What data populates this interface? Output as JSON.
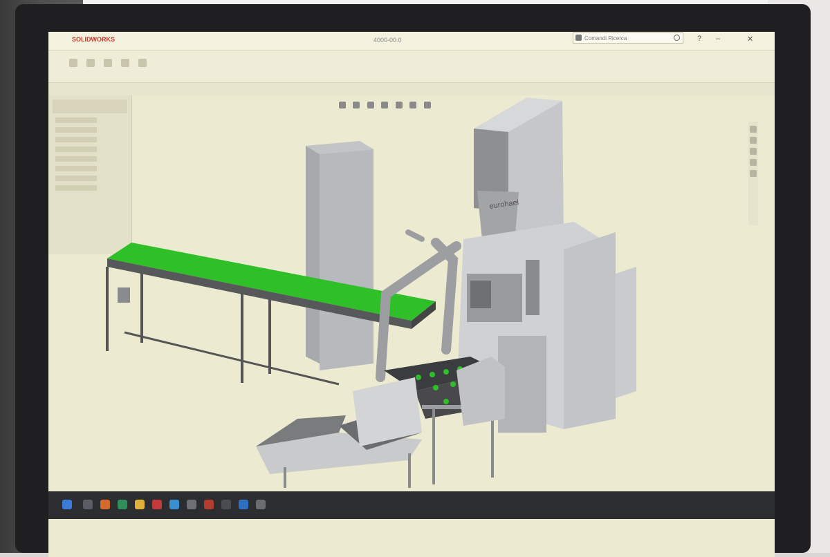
{
  "window": {
    "app_logo": "SOLIDWORKS",
    "document_title": "4000-00.0",
    "search_placeholder": "Comandi Ricerca",
    "help_label": "?",
    "minimize_label": "–",
    "close_label": "✕"
  },
  "model": {
    "brand_label": "eurohael"
  },
  "colors": {
    "viewport_bg": "#ecead0",
    "conveyor_belt": "#2fbf28",
    "machine_gray": "#c9cacc"
  },
  "icons": [
    "search-icon",
    "help-icon",
    "minimize-icon",
    "close-icon",
    "view-orientation-icon",
    "zoom-icon",
    "display-style-icon"
  ]
}
